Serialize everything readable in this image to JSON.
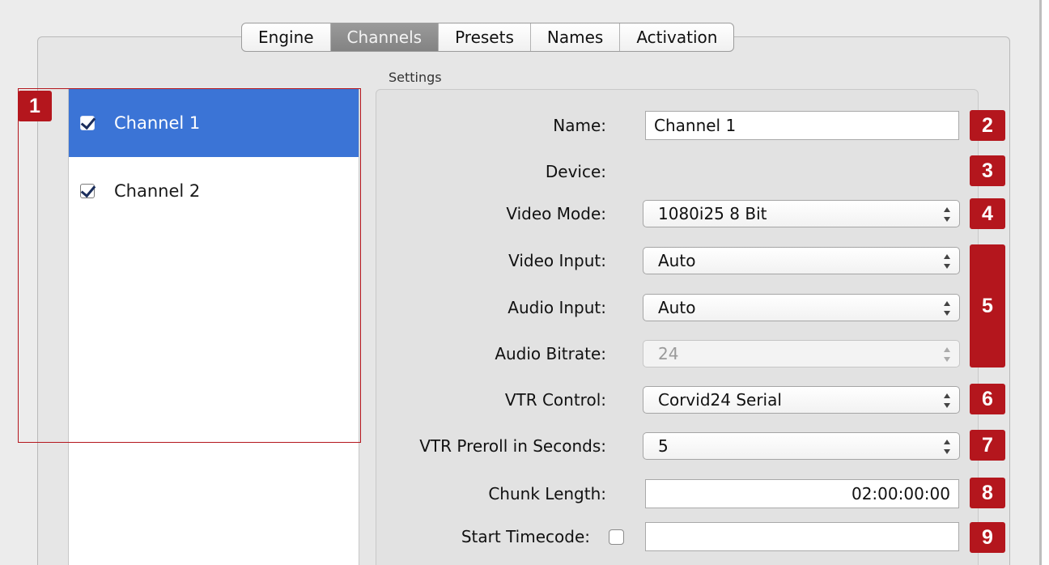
{
  "tabs": [
    {
      "label": "Engine",
      "active": false
    },
    {
      "label": "Channels",
      "active": true
    },
    {
      "label": "Presets",
      "active": false
    },
    {
      "label": "Names",
      "active": false
    },
    {
      "label": "Activation",
      "active": false
    }
  ],
  "channels": [
    {
      "label": "Channel 1",
      "checked": true,
      "selected": true
    },
    {
      "label": "Channel 2",
      "checked": true,
      "selected": false
    }
  ],
  "settings": {
    "title": "Settings",
    "name": {
      "label": "Name:",
      "value": "Channel 1"
    },
    "device": {
      "label": "Device:"
    },
    "video_mode": {
      "label": "Video Mode:",
      "value": "1080i25 8 Bit"
    },
    "video_input": {
      "label": "Video Input:",
      "value": "Auto"
    },
    "audio_input": {
      "label": "Audio Input:",
      "value": "Auto"
    },
    "audio_bitrate": {
      "label": "Audio Bitrate:",
      "value": "24",
      "disabled": true
    },
    "vtr_control": {
      "label": "VTR Control:",
      "value": "Corvid24 Serial"
    },
    "vtr_preroll": {
      "label": "VTR Preroll in Seconds:",
      "value": "5"
    },
    "chunk_length": {
      "label": "Chunk Length:",
      "value": "02:00:00:00"
    },
    "start_timecode": {
      "label": "Start Timecode:",
      "value": "",
      "checked": false
    }
  },
  "badges": [
    "1",
    "2",
    "3",
    "4",
    "5",
    "6",
    "7",
    "8",
    "9"
  ],
  "colors": {
    "accent": "#3b74d6",
    "badge": "#b4161d"
  }
}
